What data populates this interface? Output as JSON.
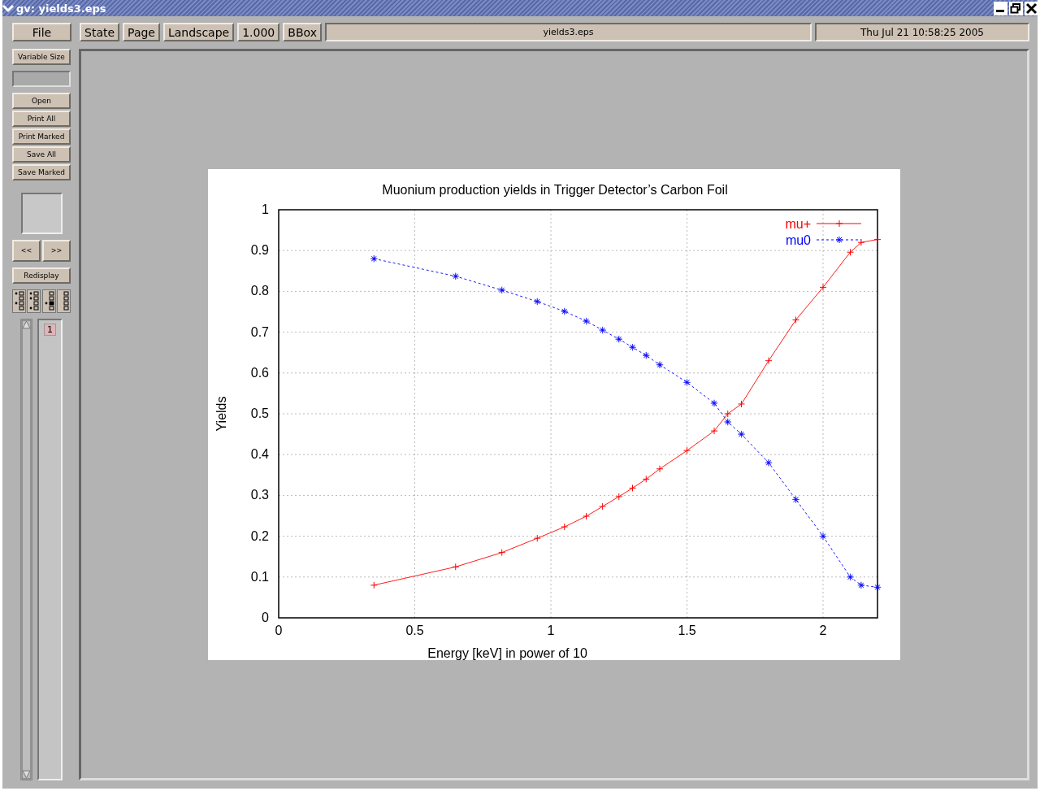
{
  "window": {
    "title": "gv: yields3.eps"
  },
  "toolbar": {
    "file": "File",
    "buttons": [
      "State",
      "Page",
      "Landscape",
      "1.000",
      "BBox"
    ],
    "filename": "yields3.eps",
    "date": "Thu Jul 21 10:58:25 2005"
  },
  "sidebar": {
    "size_button": "Variable Size",
    "buttons": [
      "Open",
      "Print All",
      "Print Marked",
      "Save All",
      "Save Marked"
    ],
    "prev": "<<",
    "next": ">>",
    "redisplay": "Redisplay",
    "pages": [
      {
        "label": "1",
        "selected": true
      }
    ]
  },
  "plot": {
    "chart_data": {
      "type": "line",
      "title": "Muonium production yields in Trigger Detector’s Carbon Foil",
      "xlabel": "Energy [keV] in power of 10",
      "ylabel": "Yields",
      "x": [
        0.35,
        0.65,
        0.82,
        0.95,
        1.05,
        1.13,
        1.19,
        1.25,
        1.3,
        1.35,
        1.4,
        1.5,
        1.6,
        1.65,
        1.7,
        1.8,
        1.9,
        2.0,
        2.1,
        2.14,
        2.2
      ],
      "series": [
        {
          "name": "mu+",
          "color": "#ff0000",
          "marker": "cross",
          "line_style": "solid",
          "values": [
            0.08,
            0.125,
            0.16,
            0.195,
            0.223,
            0.249,
            0.273,
            0.297,
            0.318,
            0.34,
            0.365,
            0.41,
            0.458,
            0.5,
            0.524,
            0.63,
            0.73,
            0.81,
            0.896,
            0.92,
            0.927
          ]
        },
        {
          "name": "mu0",
          "color": "#0000ff",
          "marker": "star",
          "line_style": "dashed",
          "values": [
            0.88,
            0.837,
            0.803,
            0.775,
            0.751,
            0.727,
            0.705,
            0.683,
            0.663,
            0.643,
            0.62,
            0.577,
            0.526,
            0.48,
            0.45,
            0.38,
            0.29,
            0.2,
            0.1,
            0.08,
            0.075
          ]
        }
      ],
      "xlim": [
        0,
        2.2
      ],
      "ylim": [
        0,
        1
      ],
      "grid": true,
      "legend": true,
      "xticks": [
        {
          "value": 0,
          "label": "0"
        },
        {
          "value": 0.5,
          "label": "0.5"
        },
        {
          "value": 1,
          "label": "1"
        },
        {
          "value": 1.5,
          "label": "1.5"
        },
        {
          "value": 2,
          "label": "2"
        }
      ],
      "yticks": [
        {
          "value": 0,
          "label": "0"
        },
        {
          "value": 0.1,
          "label": "0.1"
        },
        {
          "value": 0.2,
          "label": "0.2"
        },
        {
          "value": 0.3,
          "label": "0.3"
        },
        {
          "value": 0.4,
          "label": "0.4"
        },
        {
          "value": 0.5,
          "label": "0.5"
        },
        {
          "value": 0.6,
          "label": "0.6"
        },
        {
          "value": 0.7,
          "label": "0.7"
        },
        {
          "value": 0.8,
          "label": "0.8"
        },
        {
          "value": 0.9,
          "label": "0.9"
        },
        {
          "value": 1,
          "label": "1"
        }
      ]
    }
  }
}
